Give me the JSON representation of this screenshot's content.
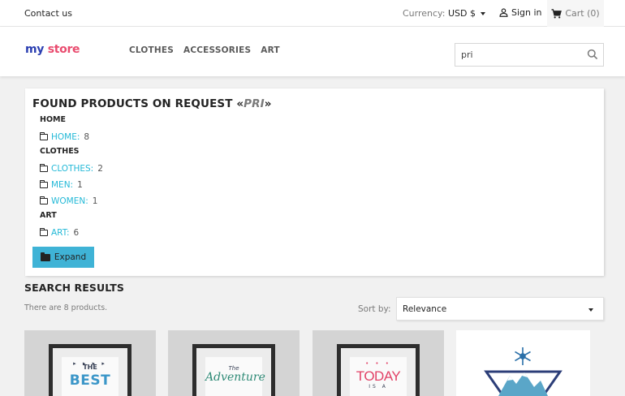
{
  "topbar": {
    "contact": "Contact us",
    "currency_label": "Currency:",
    "currency_value": "USD $",
    "sign_in": "Sign in",
    "cart": "Cart (0)"
  },
  "header": {
    "logo_part1": "my",
    "logo_part2": "store",
    "nav": [
      "CLOTHES",
      "ACCESSORIES",
      "ART"
    ],
    "search_value": "pri"
  },
  "found": {
    "title_prefix": "FOUND PRODUCTS ON REQUEST «",
    "query": "PRI",
    "title_suffix": "»",
    "groups": [
      {
        "name": "HOME",
        "items": [
          {
            "label": "HOME:",
            "count": "8"
          }
        ]
      },
      {
        "name": "CLOTHES",
        "items": [
          {
            "label": "CLOTHES:",
            "count": "2"
          },
          {
            "label": "MEN:",
            "count": "1"
          },
          {
            "label": "WOMEN:",
            "count": "1"
          }
        ]
      },
      {
        "name": "ART",
        "items": [
          {
            "label": "ART:",
            "count": "6"
          }
        ]
      }
    ],
    "expand_label": "Expand"
  },
  "results": {
    "title": "SEARCH RESULTS",
    "count_text": "There are 8 products.",
    "sort_label": "Sort by:",
    "sort_value": "Relevance"
  },
  "products": [
    {
      "art_line1": "THE",
      "art_line2": "BEST"
    },
    {
      "art_line1": "The",
      "art_line2": "Adventure"
    },
    {
      "art_line1": "TODAY",
      "art_line2": "IS A"
    },
    {
      "art_line1": "",
      "art_line2": ""
    }
  ],
  "colors": {
    "accent": "#24b9d7",
    "button": "#3fb3d6",
    "logo_my": "#2a3eb1",
    "logo_store": "#e94c6f"
  }
}
